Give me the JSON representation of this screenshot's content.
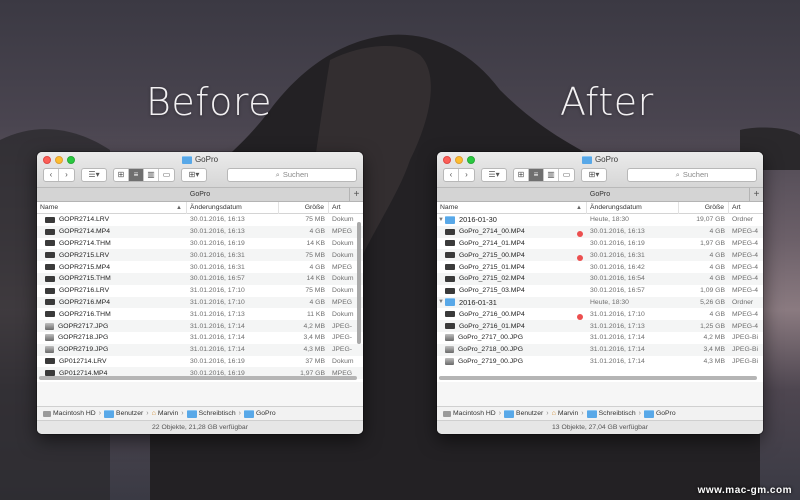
{
  "captions": {
    "before": "Before",
    "after": "After"
  },
  "watermark": "www.mac-gm.com",
  "colors": {
    "folder": "#58a8e8",
    "tag_red": "#ec4f4f",
    "close": "#fc5f57",
    "minimize": "#fdbc2e",
    "maximize": "#28c840"
  },
  "left_window": {
    "title": "GoPro",
    "search_placeholder": "Suchen",
    "tab": "GoPro",
    "columns": {
      "name": "Name",
      "date": "Änderungsdatum",
      "size": "Größe",
      "kind": "Art"
    },
    "rows": [
      {
        "name": "GOPR2714.LRV",
        "date": "30.01.2016, 16:13",
        "size": "75 MB",
        "kind": "Dokum",
        "icon": "video"
      },
      {
        "name": "GOPR2714.MP4",
        "date": "30.01.2016, 16:13",
        "size": "4 GB",
        "kind": "MPEG",
        "icon": "video"
      },
      {
        "name": "GOPR2714.THM",
        "date": "30.01.2016, 16:19",
        "size": "14 KB",
        "kind": "Dokum",
        "icon": "video"
      },
      {
        "name": "GOPR2715.LRV",
        "date": "30.01.2016, 16:31",
        "size": "75 MB",
        "kind": "Dokum",
        "icon": "video"
      },
      {
        "name": "GOPR2715.MP4",
        "date": "30.01.2016, 16:31",
        "size": "4 GB",
        "kind": "MPEG",
        "icon": "video"
      },
      {
        "name": "GOPR2715.THM",
        "date": "30.01.2016, 16:57",
        "size": "14 KB",
        "kind": "Dokum",
        "icon": "video"
      },
      {
        "name": "GOPR2716.LRV",
        "date": "31.01.2016, 17:10",
        "size": "75 MB",
        "kind": "Dokum",
        "icon": "video"
      },
      {
        "name": "GOPR2716.MP4",
        "date": "31.01.2016, 17:10",
        "size": "4 GB",
        "kind": "MPEG",
        "icon": "video"
      },
      {
        "name": "GOPR2716.THM",
        "date": "31.01.2016, 17:13",
        "size": "11 KB",
        "kind": "Dokum",
        "icon": "video"
      },
      {
        "name": "GOPR2717.JPG",
        "date": "31.01.2016, 17:14",
        "size": "4,2 MB",
        "kind": "JPEG-",
        "icon": "image"
      },
      {
        "name": "GOPR2718.JPG",
        "date": "31.01.2016, 17:14",
        "size": "3,4 MB",
        "kind": "JPEG-",
        "icon": "image"
      },
      {
        "name": "GOPR2719.JPG",
        "date": "31.01.2016, 17:14",
        "size": "4,3 MB",
        "kind": "JPEG-",
        "icon": "image"
      },
      {
        "name": "GP012714.LRV",
        "date": "30.01.2016, 16:19",
        "size": "37 MB",
        "kind": "Dokum",
        "icon": "video"
      },
      {
        "name": "GP012714.MP4",
        "date": "30.01.2016, 16:19",
        "size": "1,97 GB",
        "kind": "MPEG",
        "icon": "video"
      },
      {
        "name": "GP012715.LRV",
        "date": "30.01.2016, 16:42",
        "size": "75 MB",
        "kind": "Dokum",
        "icon": "video"
      }
    ],
    "path": [
      "Macintosh HD",
      "Benutzer",
      "Marvin",
      "Schreibtisch",
      "GoPro"
    ],
    "status": "22 Objekte, 21,28 GB verfügbar"
  },
  "right_window": {
    "title": "GoPro",
    "search_placeholder": "Suchen",
    "tab": "GoPro",
    "columns": {
      "name": "Name",
      "date": "Änderungsdatum",
      "size": "Größe",
      "kind": "Art"
    },
    "rows": [
      {
        "type": "folder",
        "name": "2016-01-30",
        "date": "Heute, 18:30",
        "size": "19,07 GB",
        "kind": "Ordner"
      },
      {
        "name": "GoPro_2714_00.MP4",
        "date": "30.01.2016, 16:13",
        "size": "4 GB",
        "kind": "MPEG-4",
        "icon": "video",
        "tag": true
      },
      {
        "name": "GoPro_2714_01.MP4",
        "date": "30.01.2016, 16:19",
        "size": "1,97 GB",
        "kind": "MPEG-4",
        "icon": "video"
      },
      {
        "name": "GoPro_2715_00.MP4",
        "date": "30.01.2016, 16:31",
        "size": "4 GB",
        "kind": "MPEG-4",
        "icon": "video",
        "tag": true
      },
      {
        "name": "GoPro_2715_01.MP4",
        "date": "30.01.2016, 16:42",
        "size": "4 GB",
        "kind": "MPEG-4",
        "icon": "video"
      },
      {
        "name": "GoPro_2715_02.MP4",
        "date": "30.01.2016, 16:54",
        "size": "4 GB",
        "kind": "MPEG-4",
        "icon": "video"
      },
      {
        "name": "GoPro_2715_03.MP4",
        "date": "30.01.2016, 16:57",
        "size": "1,09 GB",
        "kind": "MPEG-4",
        "icon": "video"
      },
      {
        "type": "folder",
        "name": "2016-01-31",
        "date": "Heute, 18:30",
        "size": "5,26 GB",
        "kind": "Ordner"
      },
      {
        "name": "GoPro_2716_00.MP4",
        "date": "31.01.2016, 17:10",
        "size": "4 GB",
        "kind": "MPEG-4",
        "icon": "video",
        "tag": true
      },
      {
        "name": "GoPro_2716_01.MP4",
        "date": "31.01.2016, 17:13",
        "size": "1,25 GB",
        "kind": "MPEG-4",
        "icon": "video"
      },
      {
        "name": "GoPro_2717_00.JPG",
        "date": "31.01.2016, 17:14",
        "size": "4,2 MB",
        "kind": "JPEG-Bi",
        "icon": "image"
      },
      {
        "name": "GoPro_2718_00.JPG",
        "date": "31.01.2016, 17:14",
        "size": "3,4 MB",
        "kind": "JPEG-Bi",
        "icon": "image"
      },
      {
        "name": "GoPro_2719_00.JPG",
        "date": "31.01.2016, 17:14",
        "size": "4,3 MB",
        "kind": "JPEG-Bi",
        "icon": "image"
      }
    ],
    "path": [
      "Macintosh HD",
      "Benutzer",
      "Marvin",
      "Schreibtisch",
      "GoPro"
    ],
    "status": "13 Objekte, 27,04 GB verfügbar"
  }
}
